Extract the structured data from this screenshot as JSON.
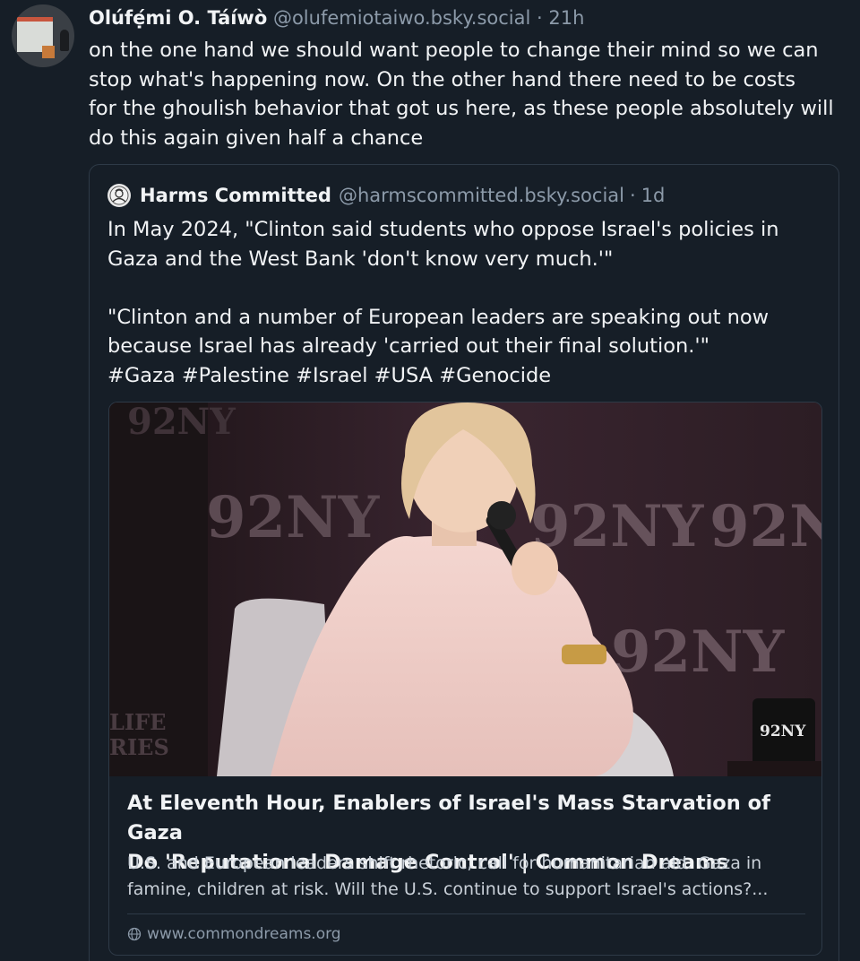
{
  "post": {
    "author": "Olúfẹ́mi O. Táíwò",
    "handle": "@olufemiotaiwo.bsky.social",
    "dot": "·",
    "time": "21h",
    "text": "on the one hand we should want people to change their mind so we can\nstop what's happening now. On the other hand there need to be costs\nfor the ghoulish behavior that got us here, as these people absolutely will\ndo this again given half a chance"
  },
  "quote": {
    "author": "Harms Committed",
    "handle": "@harmscommitted.bsky.social",
    "dot": "·",
    "time": "1d",
    "text": "In May 2024, \"Clinton said students who oppose Israel's policies in\nGaza and the West Bank 'don't know very much.'\"\n\n\"Clinton and a number of European leaders are speaking out now\nbecause Israel has already 'carried out their final solution.'\"\n#Gaza #Palestine #Israel #USA #Genocide",
    "card": {
      "image_text": [
        "92NY",
        "92NY",
        "92NY",
        "92NY",
        "92NY"
      ],
      "side_text": "LIFE\nRIES",
      "mug_text": "92NY",
      "title": "At Eleventh Hour, Enablers of Israel's Mass Starvation of Gaza\nDo 'Reputational Damage Control' | Common Dreams",
      "description": "U.S. and European leaders shift rhetoric, call for humanitarian aid. Gaza in\nfamine, children at risk. Will the U.S. continue to support Israel's actions?...",
      "domain": "www.commondreams.org"
    }
  },
  "colors": {
    "background": "#161e27",
    "border": "#2e3a47",
    "text": "#f1f3f5",
    "muted": "#8c9aa9"
  }
}
